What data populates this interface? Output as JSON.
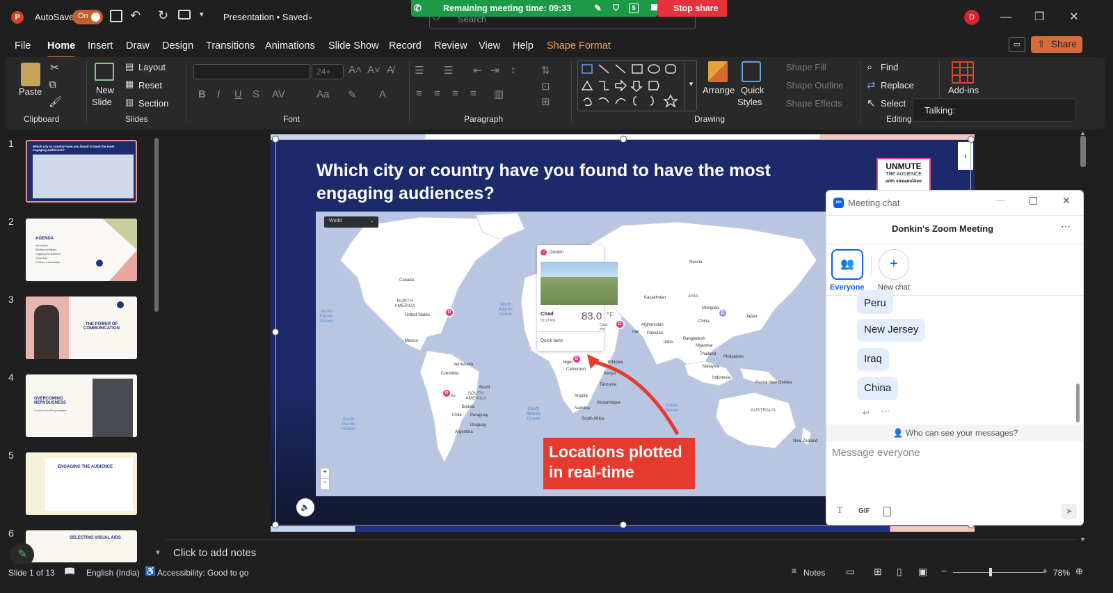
{
  "titlebar": {
    "autosave_label": "AutoSave",
    "autosave_state": "On",
    "doc_title": "Presentation • Saved",
    "user_initial": "D"
  },
  "meeting": {
    "remaining": "Remaining meeting time: 09:33",
    "stop_share": "Stop share",
    "search_placeholder": "Search"
  },
  "menu": [
    "File",
    "Home",
    "Insert",
    "Draw",
    "Design",
    "Transitions",
    "Animations",
    "Slide Show",
    "Record",
    "Review",
    "View",
    "Help",
    "Shape Format"
  ],
  "share_label": "Share",
  "ribbon": {
    "paste": "Paste",
    "new_slide": "New",
    "new_slide_2": "Slide",
    "layout": "Layout",
    "reset": "Reset",
    "section": "Section",
    "font_size": "24+",
    "arrange": "Arrange",
    "quick_styles": "Quick",
    "quick_styles_2": "Styles",
    "shape_fill": "Shape Fill",
    "shape_outline": "Shape Outline",
    "shape_effects": "Shape Effects",
    "find": "Find",
    "replace": "Replace",
    "select": "Select",
    "addins": "Add-ins",
    "talking": "Talking:",
    "groups": {
      "clipboard": "Clipboard",
      "slides": "Slides",
      "font": "Font",
      "paragraph": "Paragraph",
      "drawing": "Drawing",
      "editing": "Editing"
    }
  },
  "thumbnails": [
    {
      "num": "1",
      "title": "Which city or country have you found to have the most engaging audiences?"
    },
    {
      "num": "2",
      "title": "AGENDA",
      "lines": [
        "Introduction",
        "Building confidence",
        "Engaging the audience",
        "Visual aids",
        "Final tips & takeaways"
      ]
    },
    {
      "num": "3",
      "title": "THE POWER OF COMMUNICATION"
    },
    {
      "num": "4",
      "title": "OVERCOMING NERVOUSNESS",
      "sub": "Confidence-building strategies"
    },
    {
      "num": "5",
      "title": "ENGAGING THE AUDIENCE"
    },
    {
      "num": "6",
      "title": "SELECTING VISUAL AIDS"
    }
  ],
  "slide": {
    "title": "Which city or country have you found to have the most engaging audiences?",
    "logo_line1": "UNMUTE",
    "logo_line2": "THE AUDIENCE",
    "logo_line3": "with streamAlive",
    "map_dropdown": "World",
    "popup": {
      "user": "Donkin",
      "place": "Chad",
      "time": "09:23 PM",
      "temp": "83.0",
      "unit": "°F",
      "sky": "Clear sky",
      "facts": "Quick facts"
    },
    "callout": "Locations plotted in real-time",
    "zoom_in": "+",
    "zoom_out": "−",
    "labels": {
      "north_america": "NORTH AMERICA",
      "south_america": "SOUTH AMERICA",
      "asia": "ASIA",
      "australia": "AUSTRALIA",
      "canada": "Canada",
      "united_states": "United States",
      "mexico": "Mexico",
      "venezuela": "Venezuela",
      "colombia": "Colombia",
      "peru": "Peru",
      "brazil": "Brazil",
      "bolivia": "Bolivia",
      "chile": "Chile",
      "argentina": "Argentina",
      "paraguay": "Paraguay",
      "uruguay": "Uruguay",
      "russia": "Russia",
      "kazakhstan": "Kazakhstan",
      "mongolia": "Mongolia",
      "china": "China",
      "japan": "Japan",
      "iran": "Iran",
      "iraq": "Iraq",
      "afghanistan": "Afghanistan",
      "pakistan": "Pakistan",
      "india": "India",
      "thailand": "Thailand",
      "myanmar": "Myanmar",
      "bangladesh": "Bangladesh",
      "philippines": "Philippines",
      "indonesia": "Indonesia",
      "malaysia": "Malaysia",
      "png": "Papua New Guinea",
      "ethiopia": "Ethiopia",
      "kenya": "Kenya",
      "tanzania": "Tanzania",
      "angola": "Angola",
      "namibia": "Namibia",
      "mozambique": "Mozambique",
      "south_africa": "South Africa",
      "nigeria": "Nigeria",
      "cameroon": "Cameroon",
      "sudan": "Sudan",
      "egypt": "Egypt",
      "dr_congo": "DR Congo",
      "new_zealand": "New Zealand",
      "north_pacific": "North Pacific Ocean",
      "north_atlantic": "North Atlantic Ocean",
      "south_pacific": "South Pacific Ocean",
      "south_atlantic": "South Atlantic Ocean",
      "indian_ocean": "Indian Ocean"
    }
  },
  "chat": {
    "window_title": "Meeting chat",
    "meeting_name": "Donkin's Zoom Meeting",
    "everyone": "Everyone",
    "new_chat": "New chat",
    "messages": [
      "Peru",
      "New Jersey",
      "Iraq",
      "China"
    ],
    "who_can_see": "Who can see your messages?",
    "placeholder": "Message everyone",
    "gif": "GIF"
  },
  "notes_placeholder": "Click to add notes",
  "status": {
    "slide": "Slide 1 of 13",
    "language": "English (India)",
    "accessibility": "Accessibility: Good to go",
    "notes": "Notes",
    "zoom": "78%"
  }
}
